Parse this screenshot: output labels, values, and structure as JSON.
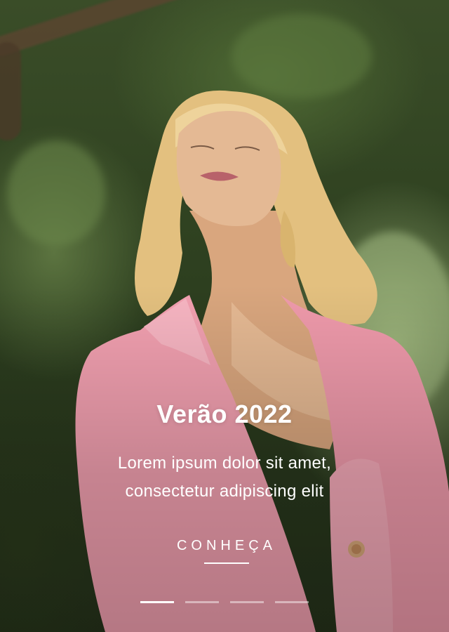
{
  "hero": {
    "title": "Verão 2022",
    "subtitle_line1": "Lorem ipsum dolor sit amet,",
    "subtitle_line2": "consectetur adipiscing elit",
    "cta_label": "CONHEÇA"
  },
  "carousel": {
    "slide_count": 4,
    "active_index": 0
  },
  "colors": {
    "text": "#ffffff",
    "jacket": "#f2a3b3",
    "hair": "#e8c98c",
    "skin": "#e3b48e",
    "foliage": "#3a4d28"
  }
}
